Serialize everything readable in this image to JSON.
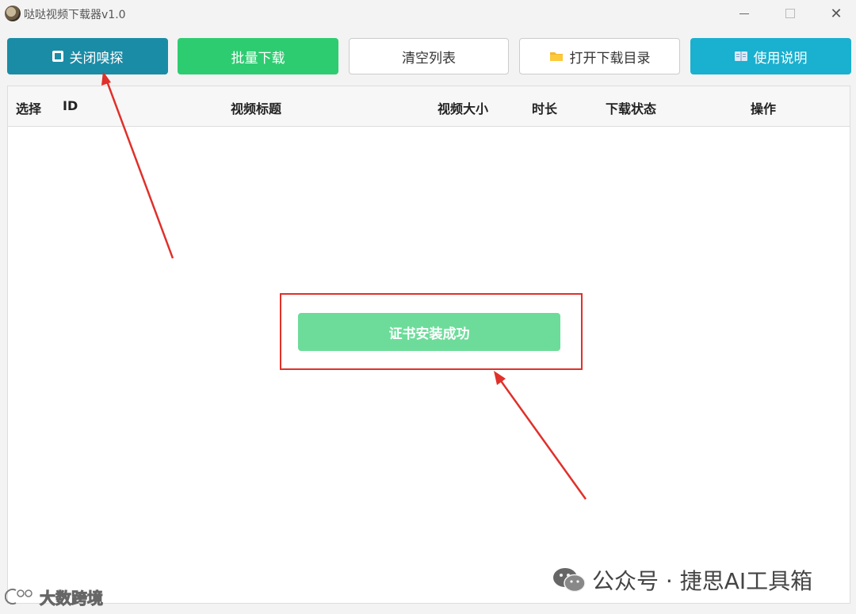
{
  "window": {
    "title": "哒哒视频下载器v1.0",
    "close_glyph": "✕"
  },
  "toolbar": {
    "stop_sniff": "关闭嗅探",
    "batch_download": "批量下载",
    "clear_list": "清空列表",
    "open_download_dir": "打开下载目录",
    "help": "使用说明"
  },
  "table": {
    "headers": [
      "选择",
      "ID",
      "视频标题",
      "视频大小",
      "时长",
      "下载状态",
      "操作"
    ],
    "rows": []
  },
  "toast": {
    "message": "证书安装成功"
  },
  "watermarks": {
    "right_text": "公众号 · 捷思AI工具箱",
    "left_text": "大数跨境"
  },
  "colors": {
    "sniff_button": "#1a8ca6",
    "batch_button": "#2ecc71",
    "help_button": "#1ab0cf",
    "toast_bg": "#6ddc9a",
    "annotation_red": "#e0302a"
  },
  "icons": {
    "stop_sniff": "stop-icon",
    "open_download_dir": "folder-icon",
    "help": "book-icon"
  }
}
